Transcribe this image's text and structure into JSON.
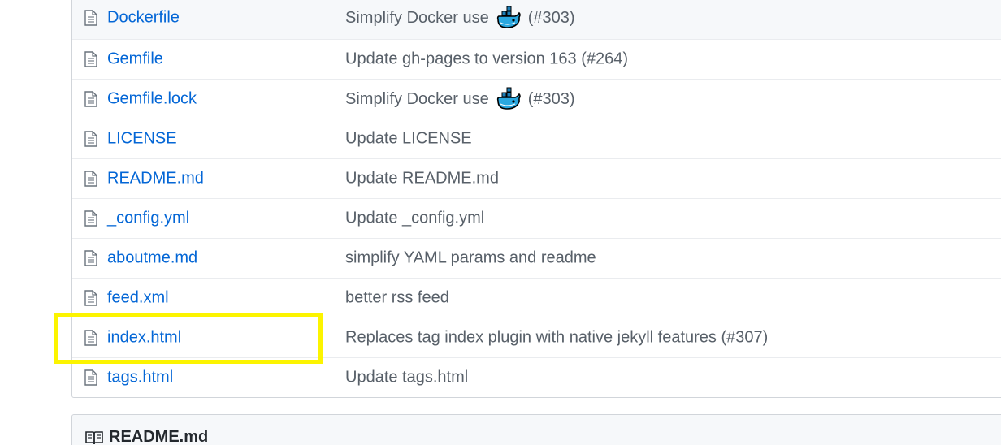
{
  "files": [
    {
      "name": "Dockerfile",
      "message": "Simplify Docker use",
      "has_whale": true,
      "pr": "(#303)"
    },
    {
      "name": "Gemfile",
      "message": "Update gh-pages to version 163 (#264)",
      "has_whale": false,
      "pr": ""
    },
    {
      "name": "Gemfile.lock",
      "message": "Simplify Docker use",
      "has_whale": true,
      "pr": "(#303)"
    },
    {
      "name": "LICENSE",
      "message": "Update LICENSE",
      "has_whale": false,
      "pr": ""
    },
    {
      "name": "README.md",
      "message": "Update README.md",
      "has_whale": false,
      "pr": ""
    },
    {
      "name": "_config.yml",
      "message": "Update _config.yml",
      "has_whale": false,
      "pr": ""
    },
    {
      "name": "aboutme.md",
      "message": "simplify YAML params and readme",
      "has_whale": false,
      "pr": ""
    },
    {
      "name": "feed.xml",
      "message": "better rss feed",
      "has_whale": false,
      "pr": ""
    },
    {
      "name": "index.html",
      "message": "Replaces tag index plugin with native jekyll features (#307)",
      "has_whale": false,
      "pr": ""
    },
    {
      "name": "tags.html",
      "message": "Update tags.html",
      "has_whale": false,
      "pr": ""
    }
  ],
  "highlighted_file": "index.html",
  "highlight_color": "#fcf400",
  "link_color": "#0366d6",
  "readme": {
    "title": "README.md"
  },
  "icons": {
    "file": "file-icon",
    "whale": "docker-whale-emoji",
    "book": "book-icon"
  }
}
